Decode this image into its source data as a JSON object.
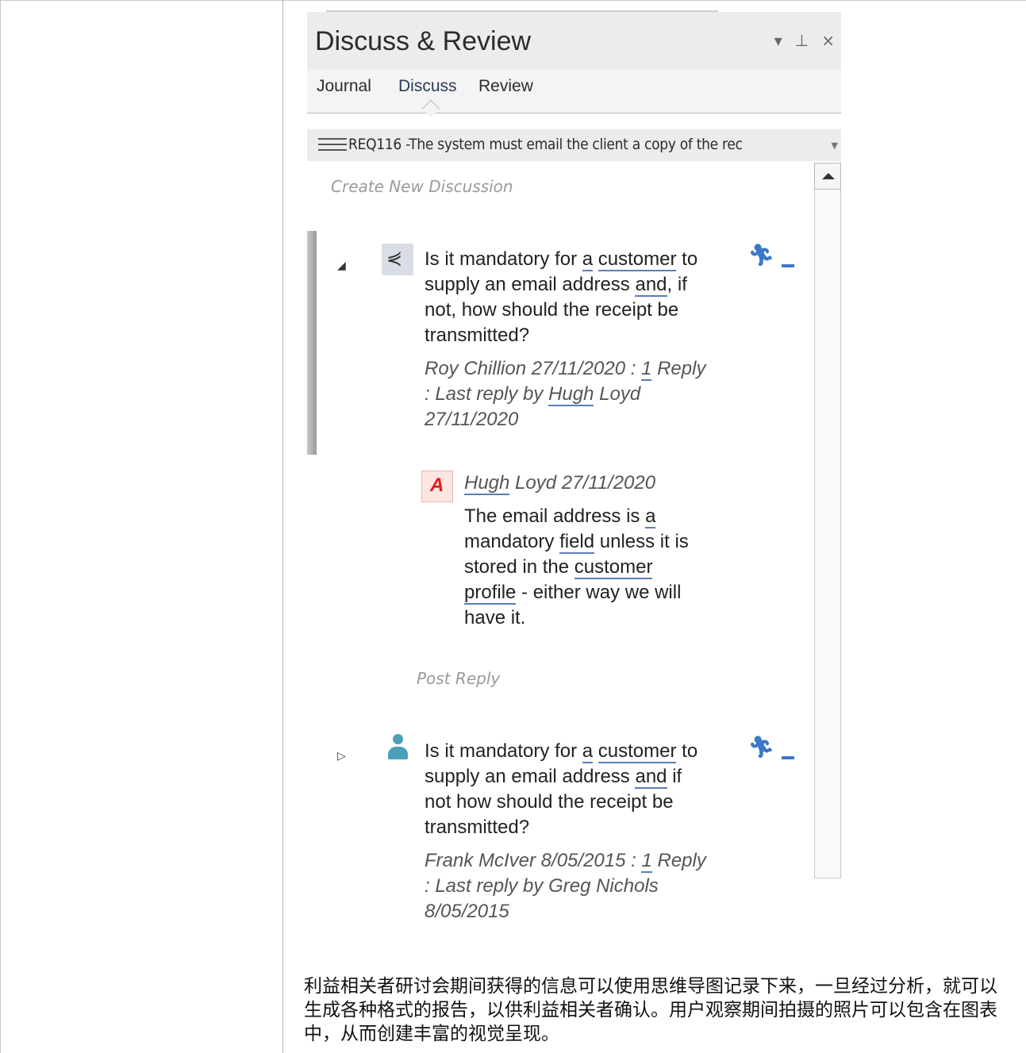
{
  "panel": {
    "title": "Discuss & Review",
    "controls": {
      "dropdown": "▾",
      "pin": "⊥",
      "close": "×"
    }
  },
  "tabs": [
    {
      "label": "Journal"
    },
    {
      "label": "Discuss"
    },
    {
      "label": "Review"
    }
  ],
  "active_tab": "Discuss",
  "selector": {
    "text": "REQ116 -The system must email the client a copy of the rec"
  },
  "create_new": "Create New Discussion",
  "thread1": {
    "line1": [
      "Is it mandatory for ",
      "a",
      " ",
      "customer",
      " to"
    ],
    "line2": [
      "supply an email address ",
      "and",
      ", if"
    ],
    "line3": "not, how should the receipt be",
    "line4": "transmitted?",
    "meta_line1": [
      "Roy Chillion 27/11/2020 : ",
      "1",
      " Reply"
    ],
    "meta_line2": [
      ": Last reply by ",
      "Hugh",
      " Loyd"
    ],
    "meta_line3": "27/11/2020"
  },
  "reply1": {
    "author_prefix": "Hugh",
    "author_rest": " Loyd  27/11/2020",
    "line1": [
      "The email address is ",
      "a"
    ],
    "line2": [
      "mandatory ",
      "field",
      " unless it is"
    ],
    "line3": [
      "stored in the ",
      "customer"
    ],
    "line4": [
      "profile",
      " - either way we will"
    ],
    "line5": "have it.",
    "icon_letter": "A"
  },
  "post_reply": "Post Reply",
  "thread2": {
    "line1": [
      "Is it mandatory for ",
      "a",
      " ",
      "customer",
      " to"
    ],
    "line2": [
      "supply an email address ",
      "and",
      " if"
    ],
    "line3": "not how should the receipt be",
    "line4": "transmitted?",
    "meta_line1": [
      "Frank McIver 8/05/2015 : ",
      "1",
      " Reply"
    ],
    "meta_line2": ": Last reply by Greg Nichols",
    "meta_line3": "8/05/2015"
  },
  "caption": "利益相关者研讨会期间获得的信息可以使用思维导图记录下来，一旦经过分析，就可以生成各种格式的报告，以供利益相关者确认。用户观察期间拍摄的照片可以包含在图表中，从而创建丰富的视觉呈现。",
  "colors": {
    "accent": "#3a78c8",
    "underline": "#5b7db8",
    "user_icon": "#4aa0b8",
    "reply_icon": "#e01b1b"
  }
}
